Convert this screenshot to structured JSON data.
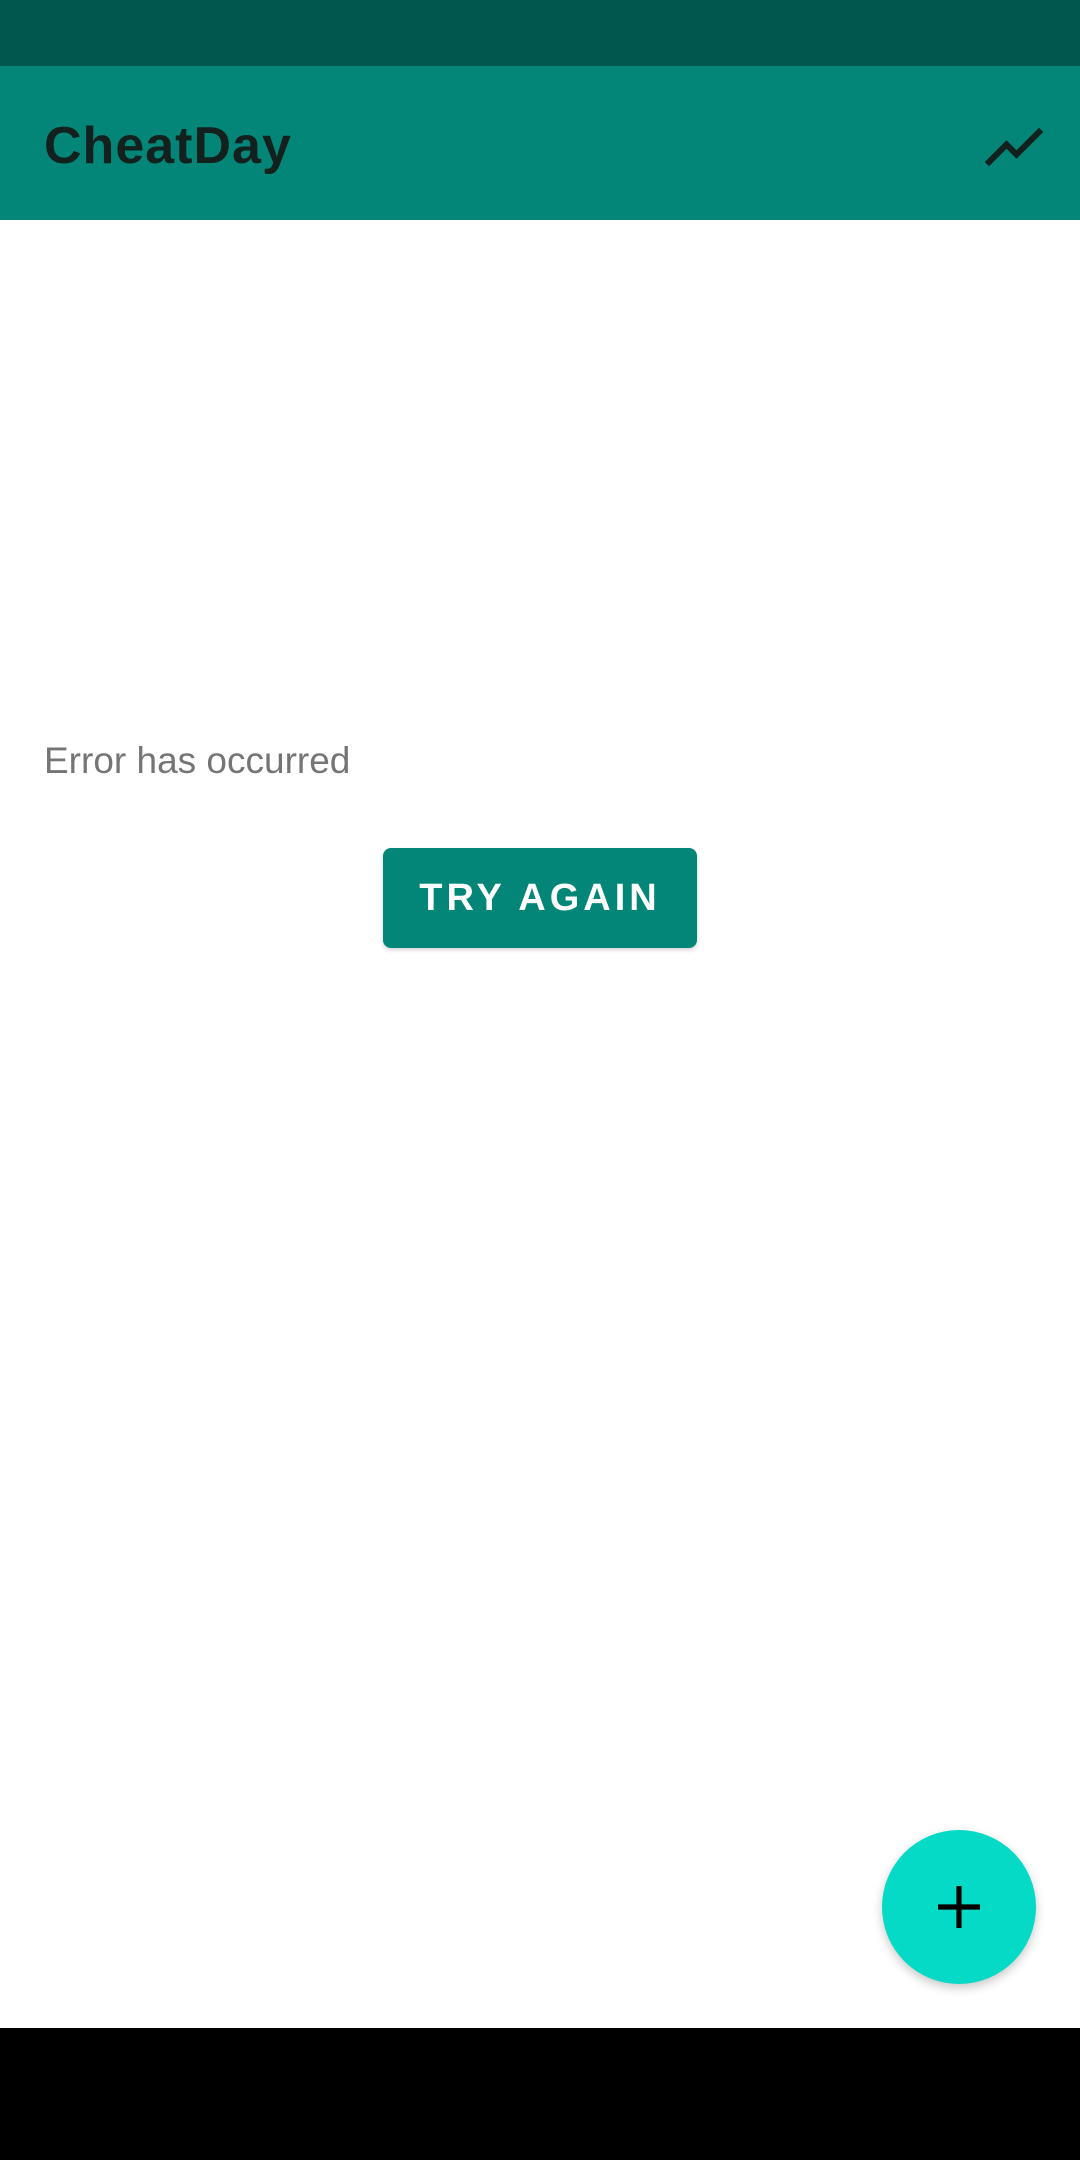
{
  "app": {
    "title": "CheatDay",
    "trend_icon": "trending-up-icon"
  },
  "content": {
    "error_message": "Error has occurred",
    "retry_label": "TRY AGAIN"
  },
  "fab": {
    "icon": "plus-icon"
  },
  "colors": {
    "status_bar": "#01574d",
    "app_bar": "#038677",
    "button": "#038677",
    "fab": "#04dac5",
    "nav_bar": "#000000"
  }
}
